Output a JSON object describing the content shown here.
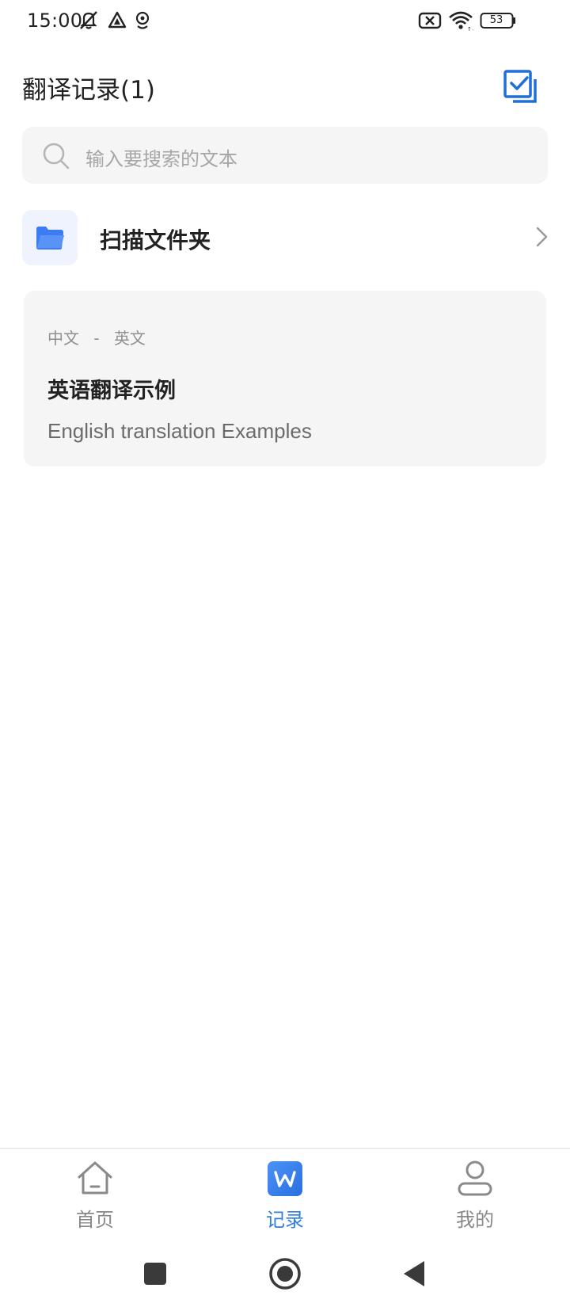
{
  "status_bar": {
    "time": "15:00",
    "battery": "53",
    "icons": [
      "mute-icon",
      "navigation-icon",
      "location-icon",
      "sim-off-icon",
      "wifi-icon",
      "battery-icon"
    ]
  },
  "header": {
    "title": "翻译记录(1)",
    "action_icon": "select-all-icon"
  },
  "search": {
    "placeholder": "输入要搜索的文本"
  },
  "folder": {
    "label": "扫描文件夹",
    "icon": "folder-icon"
  },
  "records": [
    {
      "source_lang": "中文",
      "separator": "-",
      "target_lang": "英文",
      "source_text": "英语翻译示例",
      "target_text": "English translation Examples"
    }
  ],
  "bottom_nav": {
    "items": [
      {
        "label": "首页",
        "icon": "home-icon",
        "active": false
      },
      {
        "label": "记录",
        "icon": "record-w-icon",
        "active": true
      },
      {
        "label": "我的",
        "icon": "profile-icon",
        "active": false
      }
    ]
  },
  "colors": {
    "accent": "#2f7de1",
    "folder_blue": "#3d7bf2",
    "card_bg": "#f5f5f5"
  }
}
